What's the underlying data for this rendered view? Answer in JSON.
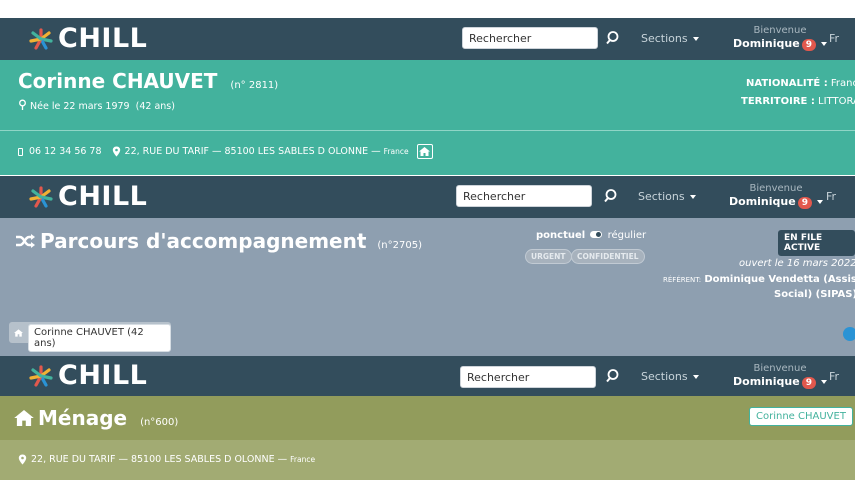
{
  "navbar": {
    "brand": "CHILL",
    "search_placeholder": "Rechercher",
    "sections_label": "Sections",
    "welcome_label": "Bienvenue",
    "user_name": "Dominique",
    "notifications_count": "9",
    "lang": "Fr"
  },
  "person": {
    "name": "Corinne CHAUVET",
    "number": "(n° 2811)",
    "birth": "Née le 22 mars 1979",
    "age": "(42 ans)",
    "nationality_label": "NATIONALITÉ :",
    "nationality": "France",
    "territory_label": "TERRITOIRE :",
    "territory": "LITTORAL",
    "phone": "06 12 34 56 78",
    "address": "22, RUE DU TARIF — 85100 LES SABLES D OLONNE —",
    "country": "France"
  },
  "parcours": {
    "title": "Parcours d'accompagnement",
    "number": "(n°2705)",
    "ponctuel": "ponctuel",
    "regulier": "régulier",
    "chip_urgent": "URGENT",
    "chip_confidentiel": "CONFIDENTIEL",
    "status": "EN FILE ACTIVE",
    "opened": "ouvert le 16 mars 2022",
    "referent_label": "RÉFÉRENT:",
    "referent_name": "Dominique Vendetta (Assistant",
    "referent_name2": "Social) (SIPAS)",
    "breadcrumb_person": "Corinne CHAUVET (42 ans)"
  },
  "menage": {
    "title": "Ménage",
    "number": "(n°600)",
    "member_button": "Corinne CHAUVET",
    "address": "22, RUE DU TARIF — 85100 LES SABLES D OLONNE —",
    "country": "France"
  },
  "colors": {
    "navbar": "#334d5c",
    "person": "#43b29d",
    "parcours": "#8e9fb0",
    "menage": "#929c5c",
    "badge": "#e2584d"
  }
}
